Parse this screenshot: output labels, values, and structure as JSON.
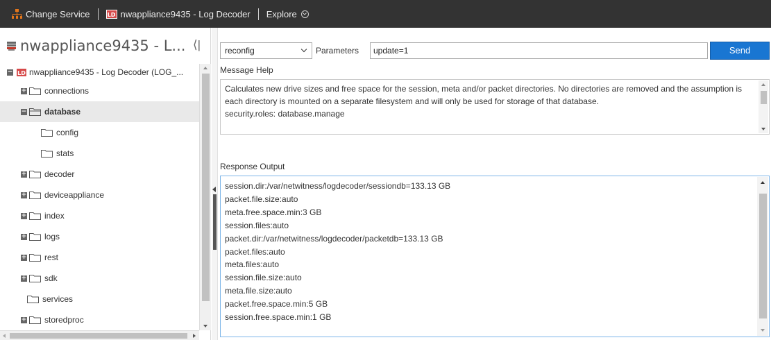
{
  "topbar": {
    "change_service": "Change Service",
    "service_name": "nwappliance9435 - Log Decoder",
    "service_badge": "LD",
    "explore": "Explore"
  },
  "left": {
    "title": "nwappliance9435 - L...",
    "collapse_glyph": "⟨|",
    "tree": {
      "root": {
        "badge": "LD",
        "label": "nwappliance9435 - Log Decoder (LOG_..."
      },
      "items": [
        {
          "label": "connections",
          "expanded": false
        },
        {
          "label": "database",
          "expanded": true,
          "selected": true
        },
        {
          "label": "config"
        },
        {
          "label": "stats"
        },
        {
          "label": "decoder",
          "expanded": false
        },
        {
          "label": "deviceappliance",
          "expanded": false
        },
        {
          "label": "index",
          "expanded": false
        },
        {
          "label": "logs",
          "expanded": false
        },
        {
          "label": "rest",
          "expanded": false
        },
        {
          "label": "sdk",
          "expanded": false
        },
        {
          "label": "services"
        },
        {
          "label": "storedproc",
          "expanded": false
        }
      ]
    }
  },
  "command": {
    "selected": "reconfig",
    "parameters_label": "Parameters",
    "parameters_value": "update=1",
    "send_label": "Send"
  },
  "help": {
    "label": "Message Help",
    "lines": [
      "Calculates new drive sizes and free space for the session, meta and/or packet directories.  No directories are removed and the assumption is each directory is mounted on a separate filesystem and will only be used for storage of that database.",
      "security.roles: database.manage"
    ]
  },
  "response": {
    "label": "Response Output",
    "lines": [
      "session.dir:/var/netwitness/logdecoder/sessiondb=133.13 GB",
      "packet.file.size:auto",
      "meta.free.space.min:3 GB",
      "session.files:auto",
      "packet.dir:/var/netwitness/logdecoder/packetdb=133.13 GB",
      "packet.files:auto",
      "meta.files:auto",
      "session.file.size:auto",
      "meta.file.size:auto",
      "packet.free.space.min:5 GB",
      "session.free.space.min:1 GB"
    ]
  },
  "colors": {
    "topbar_bg": "#333333",
    "accent_blue": "#1976d2",
    "badge_red": "#d64949",
    "selected_row": "#e9e9e9"
  },
  "icons": {
    "change_service": "hierarchy-icon",
    "service": "log-decoder-badge-icon",
    "explore": "chevron-circle-down-icon",
    "left_title": "server-icon",
    "collapse": "collapse-panel-icon",
    "tree_expand": "plus-box-icon",
    "tree_collapse": "minus-box-icon",
    "folder": "folder-icon",
    "folder_open": "folder-open-icon"
  }
}
